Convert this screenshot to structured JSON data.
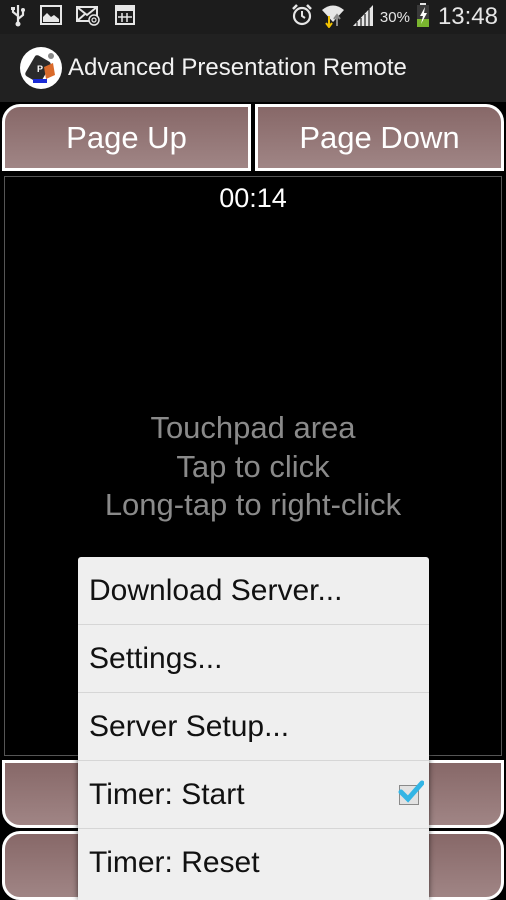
{
  "status_bar": {
    "left_icons": [
      "usb-icon",
      "image-icon",
      "email-icon",
      "screenshot-icon"
    ],
    "right_icons": [
      "alarm-icon",
      "wifi-icon",
      "signal-icon",
      "battery-charging-icon"
    ],
    "battery_percent": "30%",
    "time": "13:48"
  },
  "action_bar": {
    "app_icon": "presentation-remote-app-icon",
    "title": "Advanced Presentation Remote"
  },
  "buttons": {
    "page_up": "Page Up",
    "page_down": "Page Down"
  },
  "touchpad": {
    "timer": "00:14",
    "lines": [
      "Touchpad area",
      "Tap to click",
      "Long-tap to right-click"
    ]
  },
  "menu": {
    "items": [
      {
        "label": "Download Server..."
      },
      {
        "label": "Settings..."
      },
      {
        "label": "Server Setup..."
      },
      {
        "label": "Timer: Start",
        "checked": true
      },
      {
        "label": "Timer: Reset"
      }
    ]
  },
  "colors": {
    "button_top": "#876868",
    "button_bottom": "#a08585",
    "menu_bg": "#efefef",
    "check_accent": "#33b5e5",
    "battery_green": "#7ab52f"
  }
}
